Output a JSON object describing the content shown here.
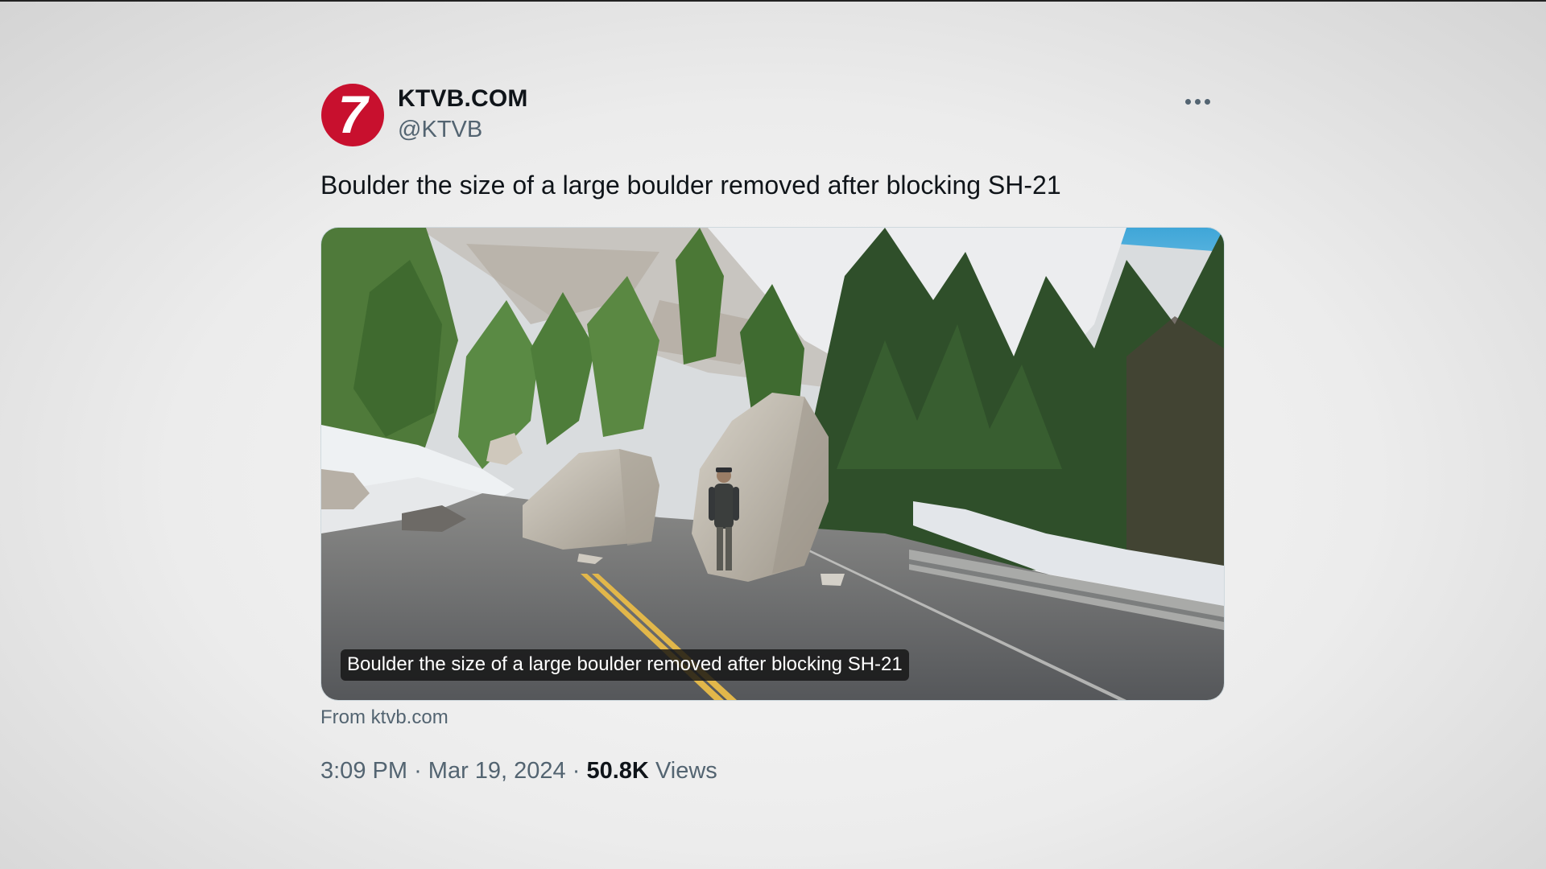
{
  "account": {
    "display_name": "KTVB.COM",
    "handle": "@KTVB",
    "avatar_text": "7",
    "brand_color": "#c8102e"
  },
  "menu": {
    "icon": "more-horizontal-icon"
  },
  "tweet": {
    "text": "Boulder the size of a large boulder removed after blocking SH-21",
    "media_caption": "Boulder the size of a large boulder removed after blocking SH-21",
    "source": "From ktvb.com",
    "time": "3:09 PM",
    "separator": "·",
    "date": "Mar 19, 2024",
    "views_count": "50.8K",
    "views_label": "Views"
  }
}
